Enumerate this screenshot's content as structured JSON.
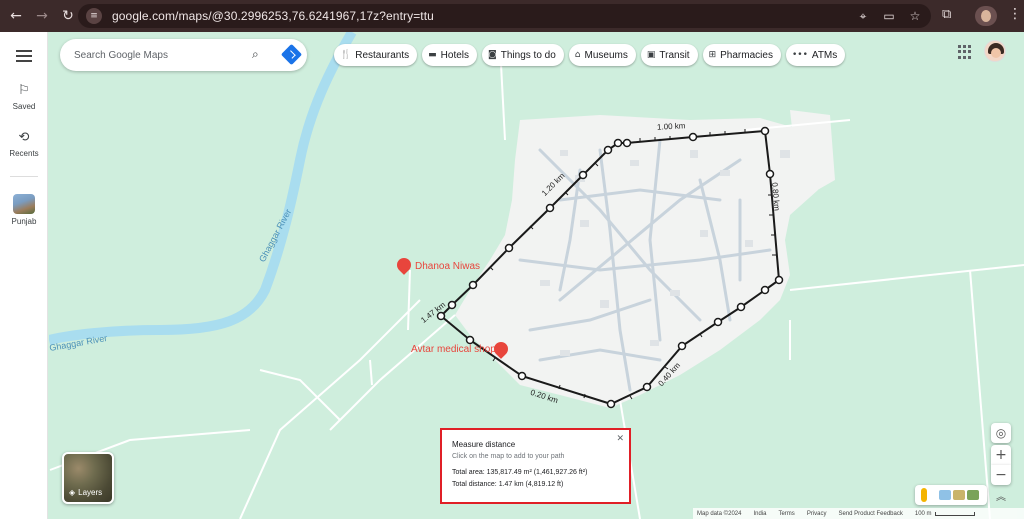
{
  "browser": {
    "url": "google.com/maps/@30.2996253,76.6241967,17z?entry=ttu"
  },
  "rail": {
    "items": [
      {
        "label": "Saved",
        "icon": "bookmark-icon"
      },
      {
        "label": "Recents",
        "icon": "history-icon"
      },
      {
        "label": "Punjab",
        "icon": "place-thumbnail"
      }
    ]
  },
  "search": {
    "placeholder": "Search Google Maps"
  },
  "chips": [
    {
      "label": "Restaurants",
      "icon": "restaurant-icon"
    },
    {
      "label": "Hotels",
      "icon": "hotel-icon"
    },
    {
      "label": "Things to do",
      "icon": "camera-icon"
    },
    {
      "label": "Museums",
      "icon": "museum-icon"
    },
    {
      "label": "Transit",
      "icon": "transit-icon"
    },
    {
      "label": "Pharmacies",
      "icon": "pharmacy-icon"
    },
    {
      "label": "ATMs",
      "icon": "more-icon"
    }
  ],
  "map": {
    "river_label_1": "Ghaggar River",
    "river_label_2": "Ghaggar River",
    "places": [
      {
        "name": "Dhanoa Niwas",
        "color": "#e8453c"
      },
      {
        "name": "Avtar medical shop",
        "color": "#e8453c"
      }
    ],
    "segment_labels": [
      "1.00 km",
      "0.80 km",
      "1.20 km",
      "1.47 km",
      "0.20 km",
      "0.40 km"
    ]
  },
  "measure": {
    "title": "Measure distance",
    "hint": "Click on the map to add to your path",
    "area": "Total area: 135,817.49 m² (1,461,927.26 ft²)",
    "distance": "Total distance: 1.47 km (4,819.12 ft)",
    "highlight_color": "#e01f26"
  },
  "layers": {
    "label": "Layers"
  },
  "attribution": {
    "map_data": "Map data ©2024",
    "india": "India",
    "terms": "Terms",
    "privacy": "Privacy",
    "feedback": "Send Product Feedback",
    "scale": "100 m"
  }
}
